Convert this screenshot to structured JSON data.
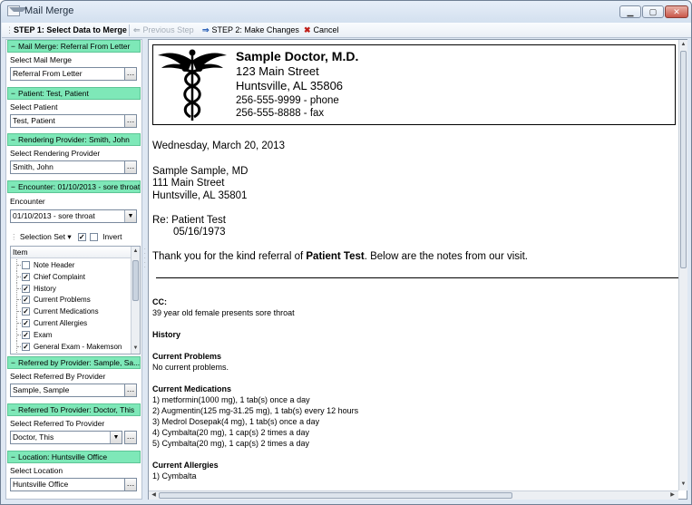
{
  "window": {
    "title": "Mail Merge",
    "minimize": "▁",
    "maximize": "▢",
    "close": "✕"
  },
  "toolbar": {
    "step1": "STEP 1: Select Data to Merge",
    "previous": "Previous Step",
    "step2": "STEP 2: Make Changes",
    "cancel": "Cancel"
  },
  "left": {
    "mail_merge": {
      "header": "Mail Merge: Referral From Letter",
      "label": "Select Mail Merge",
      "value": "Referral From Letter"
    },
    "patient": {
      "header": "Patient: Test, Patient",
      "label": "Select Patient",
      "value": "Test, Patient"
    },
    "rendering": {
      "header": "Rendering Provider: Smith, John",
      "label": "Select Rendering Provider",
      "value": "Smith, John"
    },
    "encounter": {
      "header": "Encounter: 01/10/2013 - sore throat",
      "label": "Encounter",
      "value": "01/10/2013 - sore throat"
    },
    "selection_set": "Selection Set",
    "invert": "Invert",
    "tree_header": "Item",
    "items": [
      {
        "label": "Note Header",
        "checked": false
      },
      {
        "label": "Chief Complaint",
        "checked": true
      },
      {
        "label": "History",
        "checked": true
      },
      {
        "label": "Current Problems",
        "checked": true
      },
      {
        "label": "Current Medications",
        "checked": true
      },
      {
        "label": "Current Allergies",
        "checked": true
      },
      {
        "label": "Exam",
        "checked": true
      },
      {
        "label": "General Exam - Makemson",
        "checked": true
      }
    ],
    "referred_by": {
      "header": "Referred by Provider: Sample, Sa...",
      "label": "Select Referred By Provider",
      "value": "Sample, Sample"
    },
    "referred_to": {
      "header": "Referred To Provider: Doctor, This",
      "label": "Select Referred To Provider",
      "value": "Doctor, This"
    },
    "location": {
      "header": "Location: Huntsville Office",
      "label": "Select Location",
      "value": "Huntsville Office"
    }
  },
  "letter": {
    "doctor_name": "Sample Doctor, M.D.",
    "street": "123 Main Street",
    "city": "Huntsville, AL  35806",
    "phone": "256-555-9999 - phone",
    "fax": "256-555-8888 - fax",
    "date": "Wednesday, March 20, 2013",
    "recipient_name": "Sample  Sample, MD",
    "recipient_street": "111 Main Street",
    "recipient_city": "Huntsville, AL  35801",
    "re_line": "Re:  Patient  Test",
    "re_dob": "05/16/1973",
    "thanks_pre": "Thank you for the kind referral of ",
    "thanks_patient": "Patient Test",
    "thanks_post": ".  Below are the notes from our visit.",
    "cc_label": "CC:",
    "cc_text": "39 year old female presents sore throat",
    "history_label": "History",
    "problems_label": "Current Problems",
    "problems_text": "No current problems.",
    "meds_label": "Current Medications",
    "meds": [
      "1) metformin(1000 mg), 1 tab(s) once a day",
      "2) Augmentin(125 mg-31.25 mg), 1 tab(s) every 12 hours",
      "3) Medrol Dosepak(4 mg), 1 tab(s) once a day",
      "4) Cymbalta(20 mg), 1 cap(s) 2 times a day",
      "5) Cymbalta(20 mg), 1 cap(s) 2 times a day"
    ],
    "allergies_label": "Current Allergies",
    "allergies_text": "1) Cymbalta"
  },
  "icons": [
    "app-icon",
    "arrow-left-icon",
    "arrow-right-icon",
    "cancel-icon",
    "ellipsis-icon",
    "dropdown-icon",
    "caduceus-icon"
  ]
}
